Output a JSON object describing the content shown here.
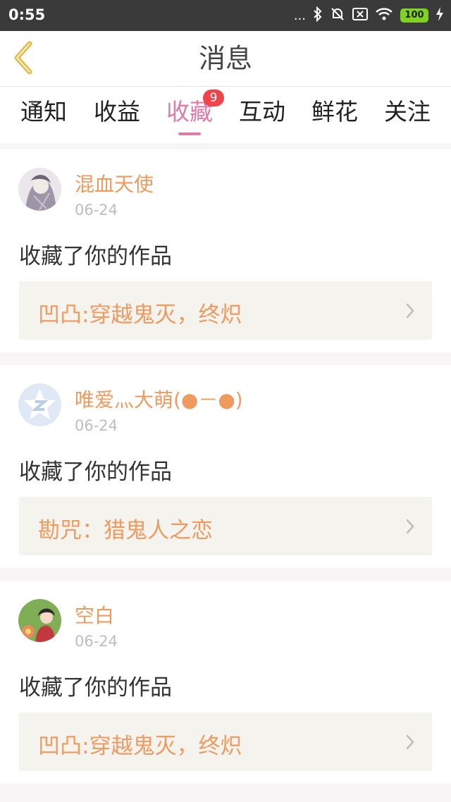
{
  "status": {
    "time": "0:55",
    "dots": "...",
    "battery": "100"
  },
  "header": {
    "title": "消息"
  },
  "tabs": [
    {
      "label": "通知"
    },
    {
      "label": "收益"
    },
    {
      "label": "收藏",
      "badge": "9"
    },
    {
      "label": "互动"
    },
    {
      "label": "鲜花"
    },
    {
      "label": "关注"
    }
  ],
  "messages": [
    {
      "username": "混血天使",
      "date": "06-24",
      "action": "收藏了你的作品",
      "work": "凹凸:穿越鬼灭，终炽"
    },
    {
      "username": "唯爱灬大萌(●－●)",
      "date": "06-24",
      "action": "收藏了你的作品",
      "work": "勘咒：猎鬼人之恋"
    },
    {
      "username": "空白",
      "date": "06-24",
      "action": "收藏了你的作品",
      "work": "凹凸:穿越鬼灭，终炽"
    }
  ],
  "colors": {
    "accent_pink": "#e27aa8",
    "username_orange": "#ef9a5f",
    "badge_red": "#f0434a",
    "back_arrow": "#e8b84a"
  },
  "icons": {
    "back": "chevron-left-icon",
    "item_arrow": "chevron-right-icon"
  }
}
